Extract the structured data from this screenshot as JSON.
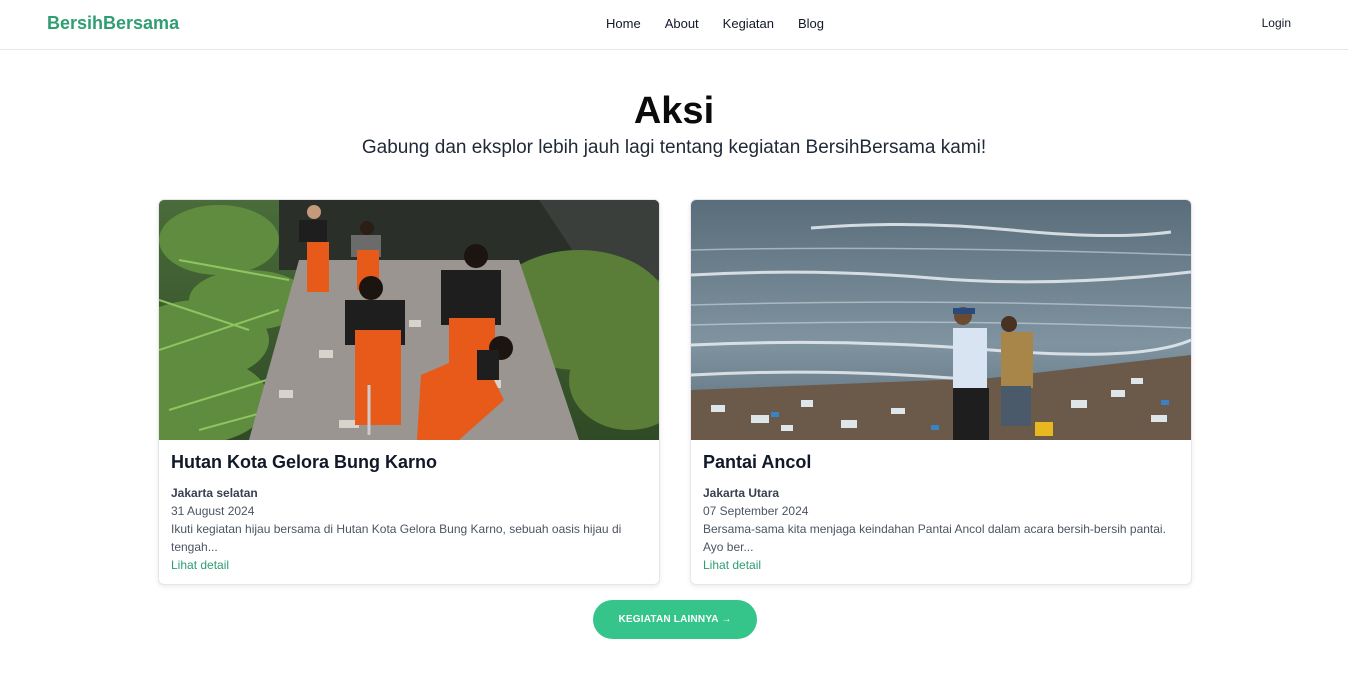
{
  "nav": {
    "brand": "BersihBersama",
    "links": [
      "Home",
      "About",
      "Kegiatan",
      "Blog"
    ],
    "login": "Login"
  },
  "hero": {
    "title": "Aksi",
    "subtitle": "Gabung dan eksplor lebih jauh lagi tentang kegiatan BersihBersama kami!"
  },
  "cards": [
    {
      "title": "Hutan Kota Gelora Bung Karno",
      "location": "Jakarta selatan",
      "date": "31 August 2024",
      "description": "Ikuti kegiatan hijau bersama di Hutan Kota Gelora Bung Karno, sebuah oasis hijau di tengah...",
      "link": "Lihat detail"
    },
    {
      "title": "Pantai Ancol",
      "location": "Jakarta Utara",
      "date": "07 September 2024",
      "description": "Bersama-sama kita menjaga keindahan Pantai Ancol dalam acara bersih-bersih pantai. Ayo ber...",
      "link": "Lihat detail"
    }
  ],
  "cta": {
    "label": "KEGIATAN LAINNYA →"
  },
  "colors": {
    "brand": "#2f9e73",
    "button": "#35c48a"
  }
}
